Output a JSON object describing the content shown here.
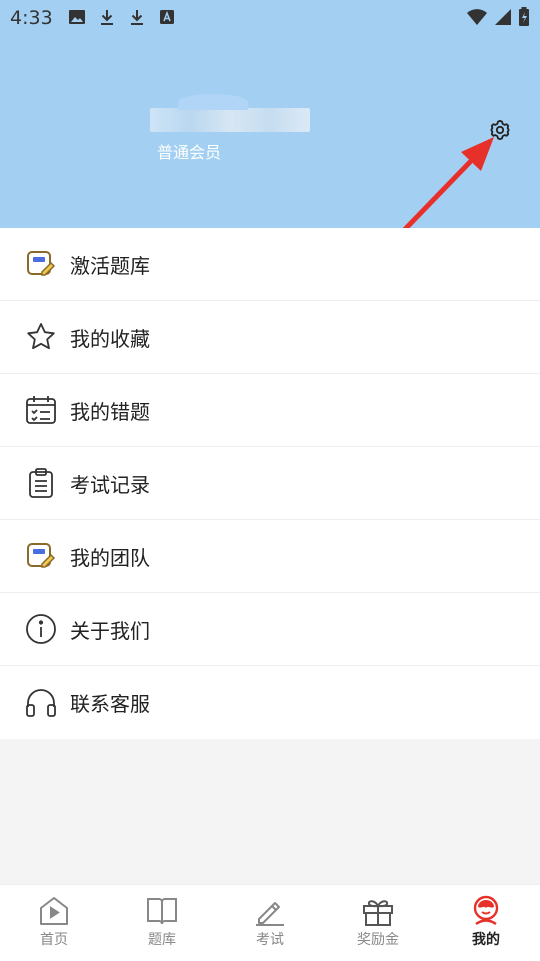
{
  "status_bar": {
    "time": "4:33"
  },
  "profile": {
    "member_level": "普通会员"
  },
  "menu": [
    {
      "label": "激活题库",
      "icon": "activate-bank-icon"
    },
    {
      "label": "我的收藏",
      "icon": "star-icon"
    },
    {
      "label": "我的错题",
      "icon": "calendar-list-icon"
    },
    {
      "label": "考试记录",
      "icon": "clipboard-icon"
    },
    {
      "label": "我的团队",
      "icon": "team-card-icon"
    },
    {
      "label": "关于我们",
      "icon": "info-icon"
    },
    {
      "label": "联系客服",
      "icon": "headset-icon"
    }
  ],
  "tabs": [
    {
      "label": "首页",
      "icon": "home-play-icon"
    },
    {
      "label": "题库",
      "icon": "book-icon"
    },
    {
      "label": "考试",
      "icon": "pencil-icon"
    },
    {
      "label": "奖励金",
      "icon": "gift-icon"
    },
    {
      "label": "我的",
      "icon": "profile-mascot-icon",
      "active": true
    }
  ],
  "colors": {
    "header_bg": "#a3d0f2",
    "accent_red": "#e8302b",
    "text": "#222222"
  }
}
